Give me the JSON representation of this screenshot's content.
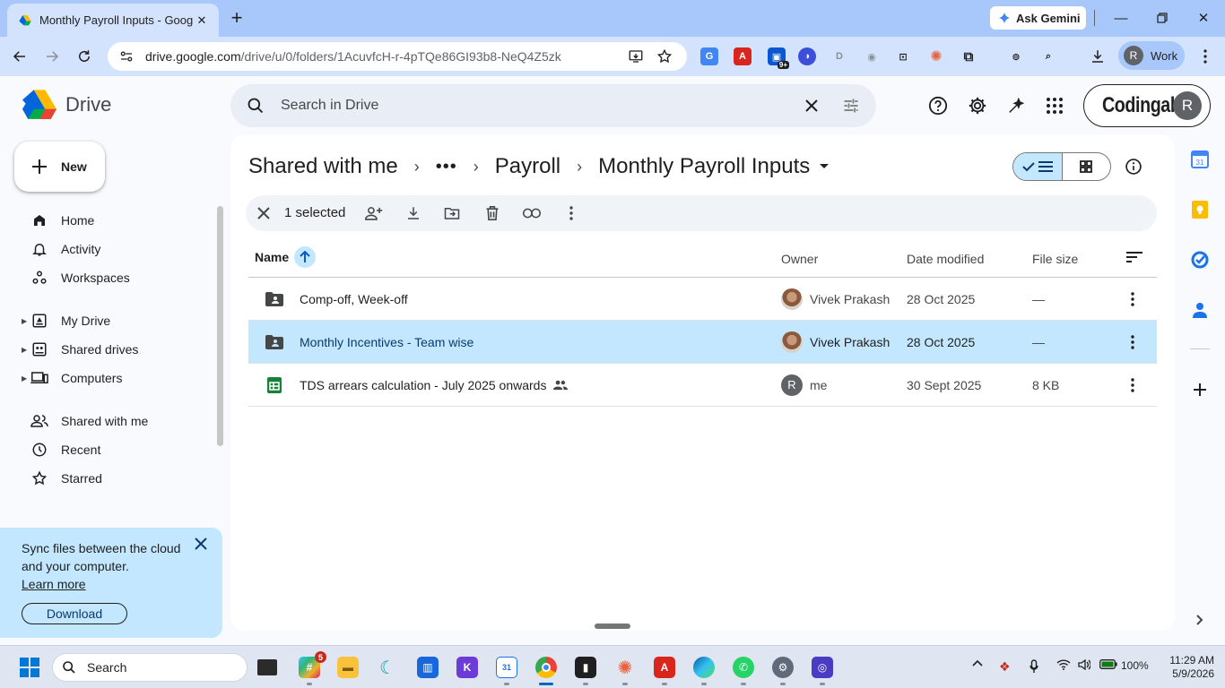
{
  "browser": {
    "tab_title": "Monthly Payroll Inputs - Google Drive",
    "ask_gemini": "Ask Gemini",
    "url_host": "drive.google.com",
    "url_path": "/drive/u/0/folders/1AcuvfcH-r-4pTQe86GI93b8-NeQ4Z5zk",
    "profile_name": "Work",
    "profile_initial": "R",
    "ext_badge": "9+"
  },
  "drive": {
    "product_name": "Drive",
    "search_placeholder": "Search in Drive",
    "org_name": "Codingal",
    "account_initial": "R"
  },
  "sidebar": {
    "new_label": "New",
    "items": [
      {
        "label": "Home",
        "icon": "home-icon"
      },
      {
        "label": "Activity",
        "icon": "bell-icon"
      },
      {
        "label": "Workspaces",
        "icon": "workspaces-icon"
      },
      {
        "label": "My Drive",
        "icon": "my-drive-icon"
      },
      {
        "label": "Shared drives",
        "icon": "shared-drives-icon"
      },
      {
        "label": "Computers",
        "icon": "computers-icon"
      },
      {
        "label": "Shared with me",
        "icon": "people-icon"
      },
      {
        "label": "Recent",
        "icon": "clock-icon"
      },
      {
        "label": "Starred",
        "icon": "star-icon"
      }
    ],
    "sync_card": {
      "text": "Sync files between the cloud and your computer.",
      "learn_more": "Learn more",
      "download": "Download"
    }
  },
  "main": {
    "breadcrumb": {
      "root": "Shared with me",
      "more": "•••",
      "parent": "Payroll",
      "current": "Monthly Payroll Inputs"
    },
    "selection": {
      "count_label": "1 selected"
    },
    "columns": {
      "name": "Name",
      "owner": "Owner",
      "modified": "Date modified",
      "size": "File size"
    },
    "rows": [
      {
        "name": "Comp-off, Week-off",
        "type": "shared-folder",
        "owner": "Vivek Prakash",
        "modified": "28 Oct 2025",
        "size": "—",
        "selected": false
      },
      {
        "name": "Monthly Incentives - Team wise",
        "type": "shared-folder",
        "owner": "Vivek Prakash",
        "modified": "28 Oct 2025",
        "size": "—",
        "selected": true
      },
      {
        "name": "TDS arrears calculation - July 2025 onwards",
        "type": "spreadsheet",
        "owner": "me",
        "owner_initial": "R",
        "modified": "30 Sept 2025",
        "size": "8 KB",
        "selected": false
      }
    ]
  },
  "taskbar": {
    "search_label": "Search",
    "slack_badge": "5",
    "battery": "100%",
    "time": "11:29 AM",
    "date": "5/9/2026"
  },
  "colors": {
    "drive_selected": "#c2e7ff",
    "chrome_frame": "#a8c7fa",
    "chrome_toolbar": "#d3e3fd",
    "sheets_green": "#188038"
  }
}
